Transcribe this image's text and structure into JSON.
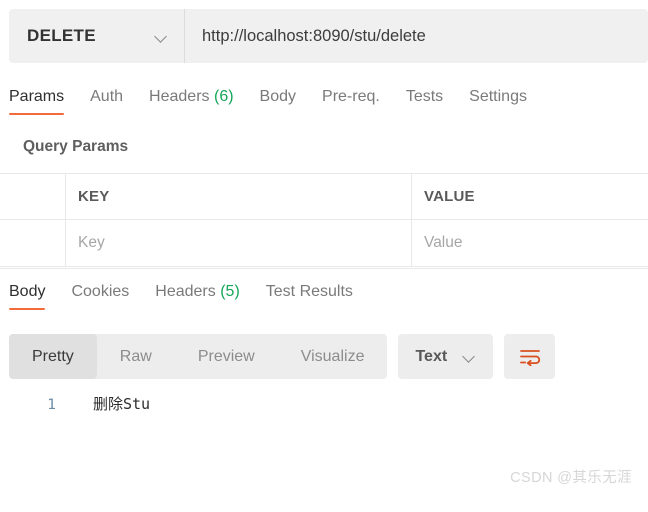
{
  "request_bar": {
    "method": "DELETE",
    "method_caret_icon": "chevron-down-icon",
    "url": "http://localhost:8090/stu/delete"
  },
  "request_tabs": [
    {
      "label": "Params",
      "count": "",
      "active": true
    },
    {
      "label": "Auth",
      "count": "",
      "active": false
    },
    {
      "label": "Headers",
      "count": "(6)",
      "active": false
    },
    {
      "label": "Body",
      "count": "",
      "active": false
    },
    {
      "label": "Pre-req.",
      "count": "",
      "active": false
    },
    {
      "label": "Tests",
      "count": "",
      "active": false
    },
    {
      "label": "Settings",
      "count": "",
      "active": false
    }
  ],
  "query_params": {
    "title": "Query Params",
    "columns": {
      "key": "KEY",
      "value": "VALUE"
    },
    "rows": [
      {
        "key_placeholder": "Key",
        "value_placeholder": "Value"
      }
    ]
  },
  "response_tabs": [
    {
      "label": "Body",
      "count": "",
      "active": true
    },
    {
      "label": "Cookies",
      "count": "",
      "active": false
    },
    {
      "label": "Headers",
      "count": "(5)",
      "active": false
    },
    {
      "label": "Test Results",
      "count": "",
      "active": false
    }
  ],
  "format_toolbar": {
    "segments": [
      {
        "label": "Pretty",
        "active": true
      },
      {
        "label": "Raw",
        "active": false
      },
      {
        "label": "Preview",
        "active": false
      },
      {
        "label": "Visualize",
        "active": false
      }
    ],
    "type_select": {
      "value": "Text",
      "caret_icon": "chevron-down-icon"
    },
    "wrap_button_icon": "wrap-text-icon"
  },
  "response_body": {
    "lines": [
      {
        "number": "1",
        "text": "删除Stu"
      }
    ]
  },
  "watermark": "CSDN @其乐无涯",
  "colors": {
    "accent": "#f26b3a",
    "count_green": "#15a65a",
    "bar_bg": "#f0f0f0",
    "segment_bg": "#ededed",
    "segment_active_bg": "#e0e0e0",
    "border": "#e8e8e8",
    "wrap_icon": "#d94f1e",
    "lineno": "#6b8ba8",
    "watermark": "#d6d6d6"
  }
}
